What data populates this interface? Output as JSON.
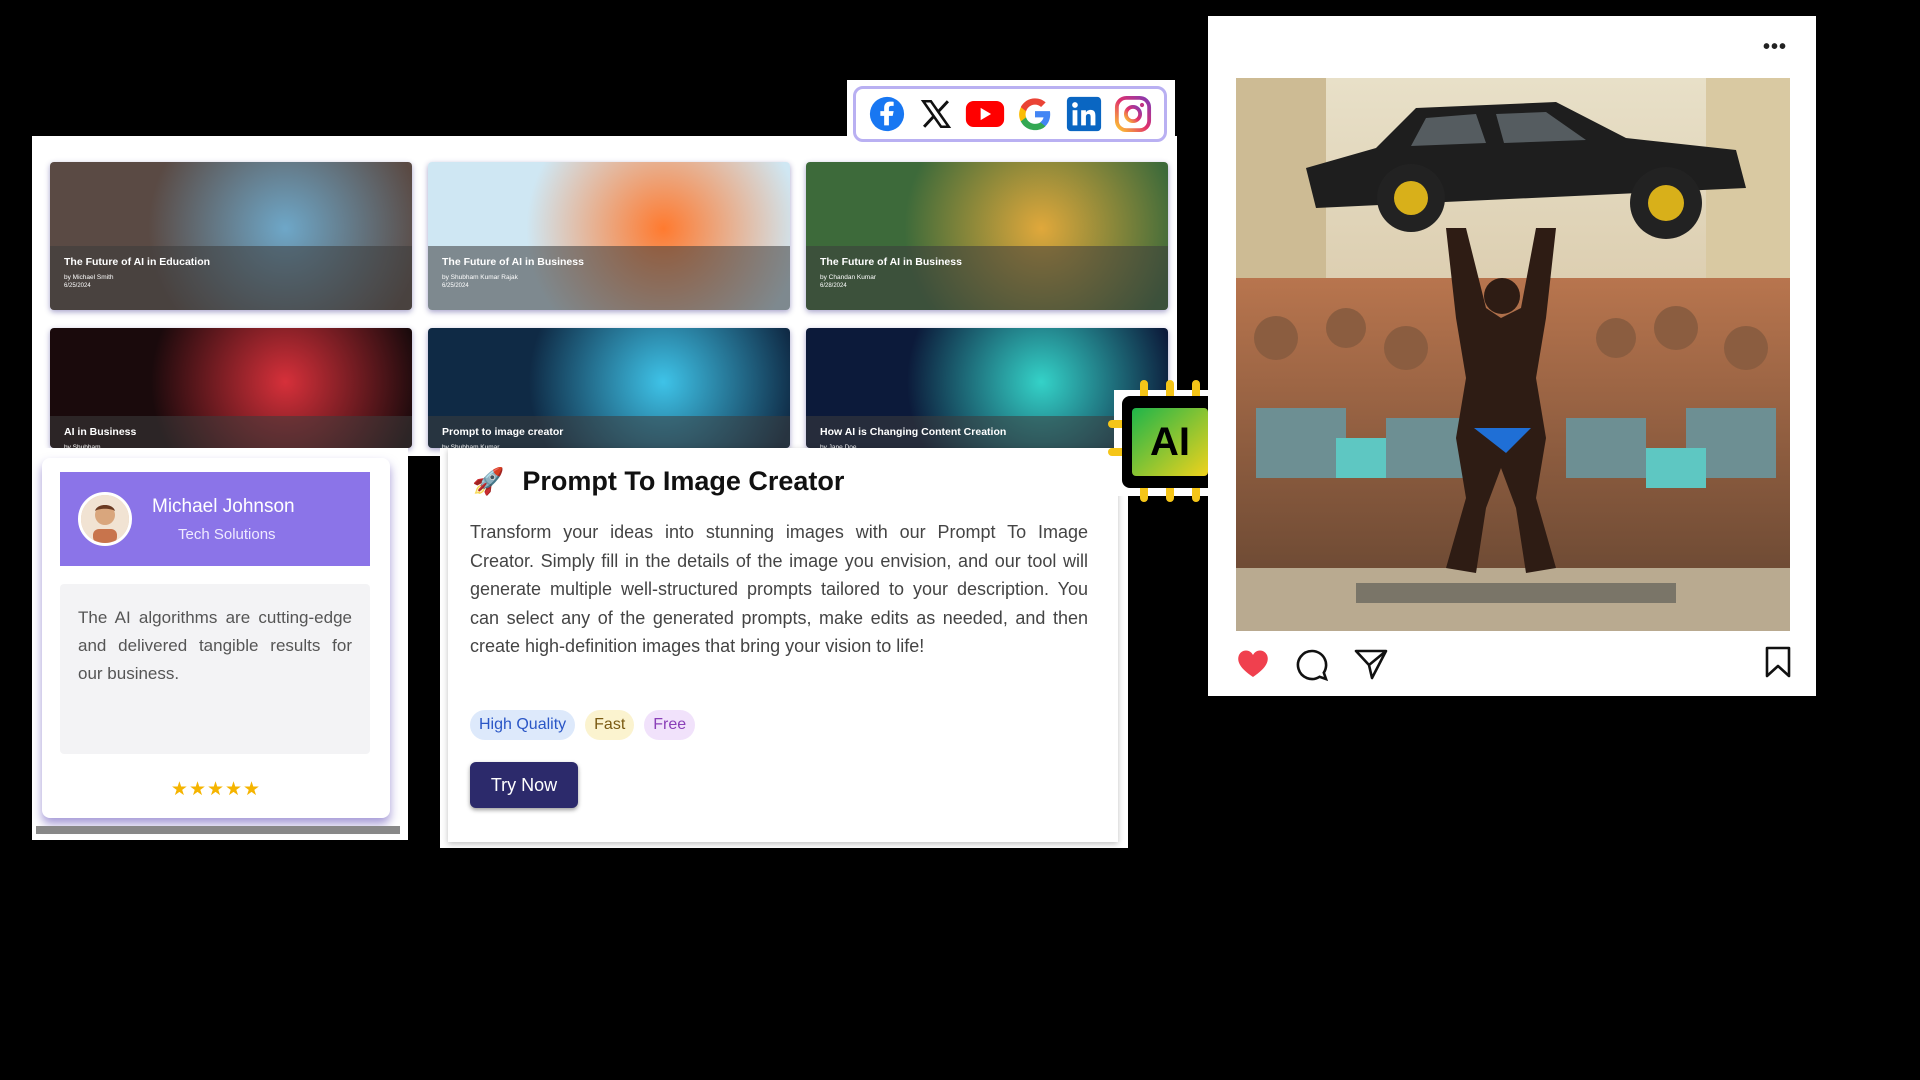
{
  "blog": {
    "cards": [
      {
        "title": "The Future of AI in Education",
        "author": "by Michael Smith",
        "date": "6/25/2024",
        "bg": "#5a4a44",
        "accent": "#6ea7c8"
      },
      {
        "title": "The Future of AI in Business",
        "author": "by Shubham Kumar Rajak",
        "date": "6/25/2024",
        "bg": "#cfe7f3",
        "accent": "#ff7a2f"
      },
      {
        "title": "The Future of AI in Business",
        "author": "by Chandan Kumar",
        "date": "6/28/2024",
        "bg": "#3d6a3a",
        "accent": "#e0a83b"
      },
      {
        "title": "AI in Business",
        "author": "by Shubham",
        "date": "",
        "bg": "#1a0a0c",
        "accent": "#d6303a"
      },
      {
        "title": "Prompt to image creator",
        "author": "by Shubham Kumar",
        "date": "",
        "bg": "#0f2a45",
        "accent": "#3ec3e8"
      },
      {
        "title": "How AI is Changing Content Creation",
        "author": "by Jane Doe",
        "date": "",
        "bg": "#0c1a3a",
        "accent": "#34d2c8"
      }
    ]
  },
  "social": {
    "icons": [
      "facebook-icon",
      "x-icon",
      "youtube-icon",
      "google-icon",
      "linkedin-icon",
      "instagram-icon"
    ]
  },
  "testimonial": {
    "name": "Michael Johnson",
    "company": "Tech Solutions",
    "quote": "The AI algorithms are cutting-edge and delivered tangible results for our business.",
    "stars": "★★★★★",
    "header_color": "#8b74e8"
  },
  "prompt": {
    "icon": "🚀",
    "title": "Prompt To Image Creator",
    "description": "Transform your ideas into stunning images with our Prompt To Image Creator. Simply fill in the details of the image you envision, and our tool will generate multiple well-structured prompts tailored to your description. You can select any of the generated prompts, make edits as needed, and then create high-definition images that bring your vision to life!",
    "tags": [
      {
        "label": "High Quality",
        "bg": "#dde9fb",
        "color": "#2a56c6"
      },
      {
        "label": "Fast",
        "bg": "#fbf3cf",
        "color": "#7a5a12"
      },
      {
        "label": "Free",
        "bg": "#f1e2fb",
        "color": "#8a3fb8"
      }
    ],
    "button_label": "Try Now"
  },
  "ai_chip": {
    "label": "AI"
  },
  "post": {
    "menu": "•••",
    "like_color": "#f0404e"
  }
}
